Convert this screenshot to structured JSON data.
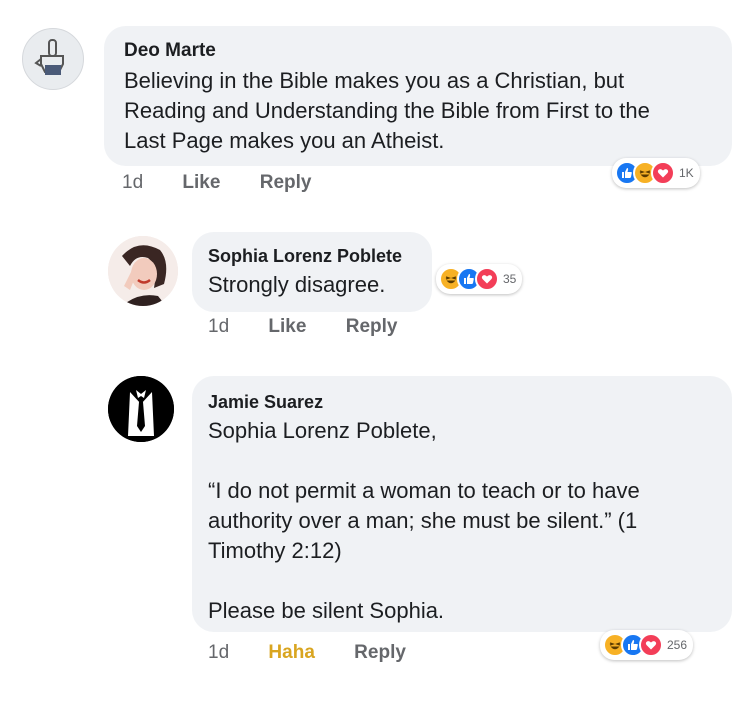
{
  "comments": [
    {
      "author": "Deo Marte",
      "text_lines": [
        "Believing in the Bible makes you as a Christian, but",
        "Reading and Understanding the Bible from First to the",
        "Last Page makes you an Atheist."
      ],
      "time": "1d",
      "like_label": "Like",
      "reply_label": "Reply",
      "reactions": [
        "like-icon",
        "haha-icon",
        "love-icon"
      ],
      "reaction_count": "1K"
    },
    {
      "author": "Sophia Lorenz Poblete",
      "text_lines": [
        "Strongly disagree."
      ],
      "time": "1d",
      "like_label": "Like",
      "reply_label": "Reply",
      "reactions": [
        "haha-icon",
        "like-icon",
        "love-icon"
      ],
      "reaction_count": "35"
    },
    {
      "author": "Jamie Suarez",
      "text_lines": [
        "Sophia Lorenz Poblete,",
        "",
        "“I do not permit a woman to teach or to have",
        "authority over a man; she must be silent.” (1",
        "Timothy 2:12)",
        "",
        "Please be silent Sophia."
      ],
      "time": "1d",
      "like_label": "Haha",
      "reply_label": "Reply",
      "reactions": [
        "haha-icon",
        "like-icon",
        "love-icon"
      ],
      "reaction_count": "256"
    }
  ],
  "colors": {
    "bubble": "#f0f2f5",
    "like_blue": "#1877f2",
    "haha_yellow": "#f7b125",
    "love_red": "#f33e58",
    "meta_gray": "#65676b",
    "haha_text": "#d9a520"
  }
}
